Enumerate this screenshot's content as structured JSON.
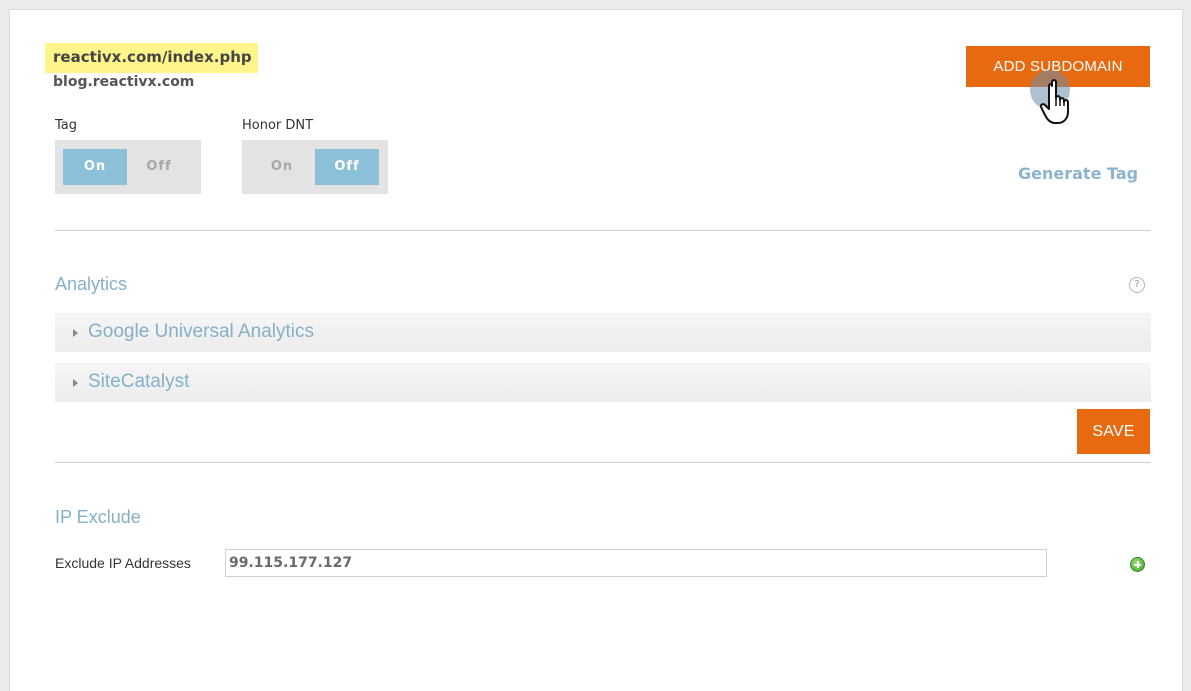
{
  "domains": {
    "primary": "reactivx.com/index.php",
    "secondary": "blog.reactivx.com"
  },
  "buttons": {
    "add_subdomain": "ADD SUBDOMAIN",
    "save": "SAVE"
  },
  "toggles": {
    "tag": {
      "label": "Tag",
      "on": "On",
      "off": "Off",
      "selected": "On"
    },
    "honor_dnt": {
      "label": "Honor DNT",
      "on": "On",
      "off": "Off",
      "selected": "Off"
    }
  },
  "generate_tag": "Generate Tag",
  "analytics": {
    "title": "Analytics",
    "help_icon": "?",
    "items": [
      {
        "label": "Google Universal Analytics"
      },
      {
        "label": "SiteCatalyst"
      }
    ]
  },
  "ip_exclude": {
    "title": "IP Exclude",
    "field_label": "Exclude IP Addresses",
    "value": "99.115.177.127"
  },
  "icons": {
    "help": "question-circle-icon",
    "add": "plus-circle-icon",
    "cursor": "hand-pointer-icon",
    "accordion": "triangle-right-icon"
  },
  "colors": {
    "accent_orange": "#e86a10",
    "toggle_active": "#8cc0d8",
    "link_blue": "#84b0c9",
    "highlight": "#fff58a"
  }
}
